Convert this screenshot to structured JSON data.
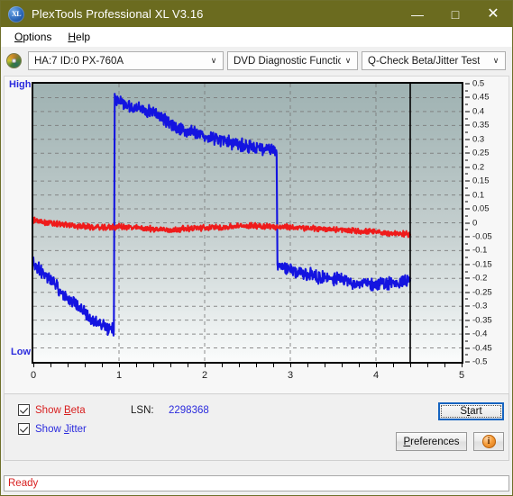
{
  "window": {
    "title": "PlexTools Professional XL V3.16",
    "app_icon": "xl-disc-icon",
    "minimize": "—",
    "maximize": "□",
    "close": "✕"
  },
  "menubar": {
    "items": [
      {
        "label": "Options",
        "mnemonic": "O"
      },
      {
        "label": "Help",
        "mnemonic": "H"
      }
    ]
  },
  "toolbar": {
    "drive_icon": "optical-disc-icon",
    "drive_select": {
      "value": "HA:7 ID:0  PX-760A",
      "chevron": "∨"
    },
    "function_select": {
      "value": "DVD Diagnostic Functions",
      "chevron": "∨"
    },
    "test_select": {
      "value": "Q-Check Beta/Jitter Test",
      "chevron": "∨"
    }
  },
  "controls": {
    "show_beta": {
      "label_pre": "Show ",
      "mnemonic": "B",
      "label_post": "eta",
      "checked": true,
      "color": "#d81f1f"
    },
    "show_jitter": {
      "label_pre": "Show ",
      "mnemonic": "J",
      "label_post": "itter",
      "checked": true,
      "color": "#2b2bdd"
    },
    "lsn_label": "LSN:",
    "lsn_value": "2298368",
    "start_button": {
      "pre": "S",
      "mnemonic": "t",
      "post": "art",
      "focused": true
    },
    "preferences_button": {
      "pre": "",
      "mnemonic": "P",
      "post": "references"
    },
    "info_button": {
      "glyph": "i",
      "name": "info-icon"
    }
  },
  "statusbar": {
    "text": "Ready"
  },
  "chart_data": {
    "type": "line",
    "title": "Q-Check Beta/Jitter Test",
    "xlabel": "",
    "ylabel_left_top": "High",
    "ylabel_left_bottom": "Low",
    "xlim": [
      0,
      5
    ],
    "ylim": [
      -0.5,
      0.5
    ],
    "xticks": [
      0,
      1,
      2,
      3,
      4,
      5
    ],
    "xtick_labels": [
      "0",
      "1",
      "2",
      "3",
      "4",
      "5"
    ],
    "yticks": [
      0.5,
      0.45,
      0.4,
      0.35,
      0.3,
      0.25,
      0.2,
      0.15,
      0.1,
      0.05,
      0,
      -0.05,
      -0.1,
      -0.15,
      -0.2,
      -0.25,
      -0.3,
      -0.35,
      -0.4,
      -0.45,
      -0.5
    ],
    "ytick_labels": [
      "0.5",
      "0.45",
      "0.4",
      "0.35",
      "0.3",
      "0.25",
      "0.2",
      "0.15",
      "0.1",
      "0.05",
      "0",
      "-0.05",
      "-0.1",
      "-0.15",
      "-0.2",
      "-0.25",
      "-0.3",
      "-0.35",
      "-0.4",
      "-0.45",
      "-0.5"
    ],
    "grid": true,
    "grid_style": "dashed",
    "grid_color": "#7a7a7a",
    "plot_background": "gradient teal-grey to white",
    "data_end_marker_x": 4.4,
    "series": [
      {
        "name": "Jitter",
        "color": "#1414e0",
        "legend": "Show Jitter",
        "x": [
          0.0,
          0.05,
          0.1,
          0.15,
          0.2,
          0.25,
          0.3,
          0.35,
          0.4,
          0.45,
          0.5,
          0.55,
          0.6,
          0.65,
          0.7,
          0.75,
          0.8,
          0.85,
          0.9,
          0.94,
          0.95,
          1.0,
          1.05,
          1.1,
          1.15,
          1.2,
          1.25,
          1.3,
          1.35,
          1.4,
          1.45,
          1.5,
          1.55,
          1.6,
          1.65,
          1.7,
          1.75,
          1.8,
          1.85,
          1.9,
          1.95,
          2.0,
          2.1,
          2.2,
          2.3,
          2.4,
          2.5,
          2.6,
          2.7,
          2.8,
          2.84,
          2.85,
          2.9,
          2.95,
          3.0,
          3.1,
          3.2,
          3.3,
          3.4,
          3.5,
          3.6,
          3.7,
          3.8,
          3.9,
          4.0,
          4.1,
          4.2,
          4.3,
          4.4
        ],
        "y": [
          -0.145,
          -0.16,
          -0.175,
          -0.19,
          -0.205,
          -0.22,
          -0.24,
          -0.255,
          -0.27,
          -0.282,
          -0.3,
          -0.31,
          -0.32,
          -0.335,
          -0.35,
          -0.36,
          -0.372,
          -0.378,
          -0.382,
          -0.385,
          0.45,
          0.44,
          0.432,
          0.424,
          0.418,
          0.412,
          0.408,
          0.402,
          0.398,
          0.392,
          0.385,
          0.372,
          0.368,
          0.36,
          0.345,
          0.34,
          0.335,
          0.33,
          0.325,
          0.32,
          0.316,
          0.312,
          0.305,
          0.298,
          0.29,
          0.282,
          0.276,
          0.27,
          0.264,
          0.258,
          0.252,
          -0.152,
          -0.16,
          -0.166,
          -0.17,
          -0.178,
          -0.185,
          -0.19,
          -0.196,
          -0.2,
          -0.206,
          -0.212,
          -0.216,
          -0.22,
          -0.222,
          -0.218,
          -0.216,
          -0.212,
          -0.208
        ],
        "noise_amplitude": 0.018,
        "description": "Jitter trace: descends from -0.145 to -0.385 over 0-0.95, steps up to +0.45, decays to +0.252 by 2.84, steps down to -0.152, drifts to -0.208 at x=4.4"
      },
      {
        "name": "Beta",
        "color": "#ef1b1b",
        "legend": "Show Beta",
        "x": [
          0.0,
          0.2,
          0.4,
          0.6,
          0.8,
          1.0,
          1.2,
          1.4,
          1.6,
          1.8,
          2.0,
          2.2,
          2.4,
          2.6,
          2.8,
          3.0,
          3.2,
          3.4,
          3.6,
          3.8,
          4.0,
          4.2,
          4.4
        ],
        "y": [
          0.01,
          -0.002,
          -0.008,
          -0.014,
          -0.018,
          -0.014,
          -0.018,
          -0.022,
          -0.026,
          -0.02,
          -0.018,
          -0.016,
          -0.012,
          -0.01,
          -0.014,
          -0.016,
          -0.02,
          -0.022,
          -0.026,
          -0.03,
          -0.034,
          -0.038,
          -0.042
        ],
        "noise_amplitude": 0.008,
        "description": "Beta trace: near zero, slow decline from +0.01 to -0.042 across the disc"
      }
    ]
  }
}
